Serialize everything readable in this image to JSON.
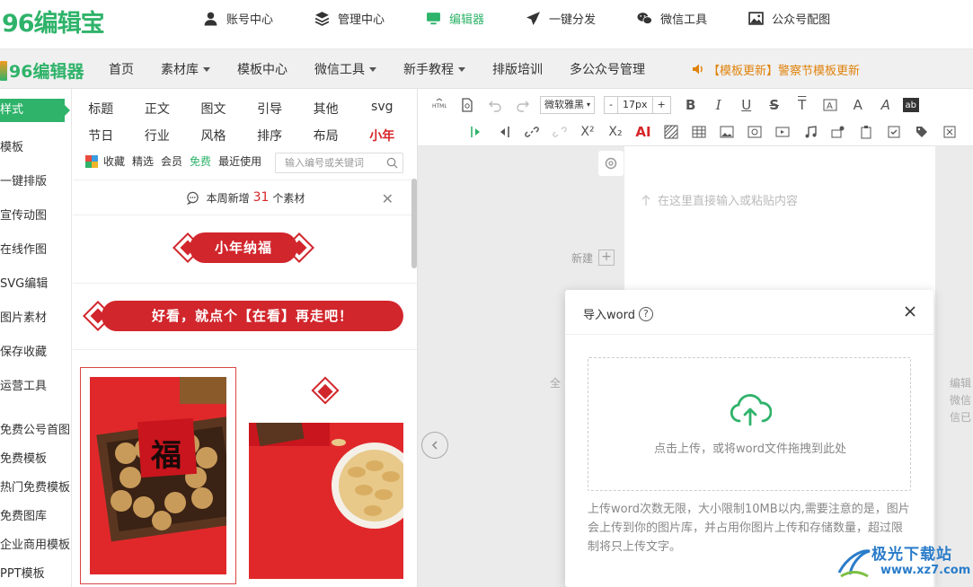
{
  "app": {
    "logo_text": "96编辑宝",
    "sub_logo_text": "96编辑器"
  },
  "top_nav": [
    {
      "label": "账号中心",
      "icon": "user-icon"
    },
    {
      "label": "管理中心",
      "icon": "layers-icon"
    },
    {
      "label": "编辑器",
      "icon": "monitor-icon",
      "active": true
    },
    {
      "label": "一键分发",
      "icon": "send-icon"
    },
    {
      "label": "微信工具",
      "icon": "wechat-icon"
    },
    {
      "label": "公众号配图",
      "icon": "image-icon"
    }
  ],
  "sub_nav": [
    {
      "label": "首页",
      "dropdown": false
    },
    {
      "label": "素材库",
      "dropdown": true
    },
    {
      "label": "模板中心",
      "dropdown": false
    },
    {
      "label": "微信工具",
      "dropdown": true
    },
    {
      "label": "新手教程",
      "dropdown": true
    },
    {
      "label": "排版培训",
      "dropdown": false
    },
    {
      "label": "多公众号管理",
      "dropdown": false
    }
  ],
  "notice": "【模板更新】警察节模板更新",
  "sidebar": [
    {
      "label": "样式",
      "active": true
    },
    {
      "label": "模板"
    },
    {
      "label": "一键排版"
    },
    {
      "label": "宣传动图"
    },
    {
      "label": "在线作图"
    },
    {
      "label": "SVG编辑"
    },
    {
      "label": "图片素材"
    },
    {
      "label": "保存收藏"
    },
    {
      "label": "运营工具"
    },
    {
      "label": "免费公号首图"
    },
    {
      "label": "免费模板"
    },
    {
      "label": "热门免费模板"
    },
    {
      "label": "免费图库"
    },
    {
      "label": "企业商用模板"
    },
    {
      "label": "PPT模板"
    }
  ],
  "categories_row1": [
    "标题",
    "正文",
    "图文",
    "引导",
    "其他",
    "svg"
  ],
  "categories_row2": [
    "节日",
    "行业",
    "风格",
    "排序",
    "布局",
    "小年"
  ],
  "filters": [
    "收藏",
    "精选",
    "会员",
    "免费",
    "最近使用"
  ],
  "search": {
    "placeholder": "输入编号或关键词"
  },
  "weekly": {
    "prefix": "本周新增",
    "count": "31",
    "suffix": "个素材"
  },
  "banners": [
    "小年纳福",
    "好看，就点个【在看】再走吧！"
  ],
  "thumb_text": "福",
  "toolbar": {
    "font": "微软雅黑",
    "size": "17px",
    "size_minus": "-",
    "size_plus": "+"
  },
  "editor": {
    "hint": "在这里直接输入或粘贴内容",
    "new_label": "新建",
    "edge_text": "全",
    "right_text": [
      "编辑",
      "微信",
      "信已"
    ]
  },
  "modal": {
    "title": "导入word",
    "help": "?",
    "upload_text": "点击上传，或将word文件拖拽到此处",
    "note": "上传word次数无限，大小限制10MB以内,需要注意的是，图片会上传到你的图片库，并占用你图片上传和存储数量，超过限制将只上传文字。"
  },
  "watermark": {
    "name": "极光下载站",
    "url": "www.xz7.com"
  },
  "colors": {
    "brand_green": "#2fb36a",
    "accent_red": "#d6262a",
    "notice_orange": "#e0820b"
  }
}
